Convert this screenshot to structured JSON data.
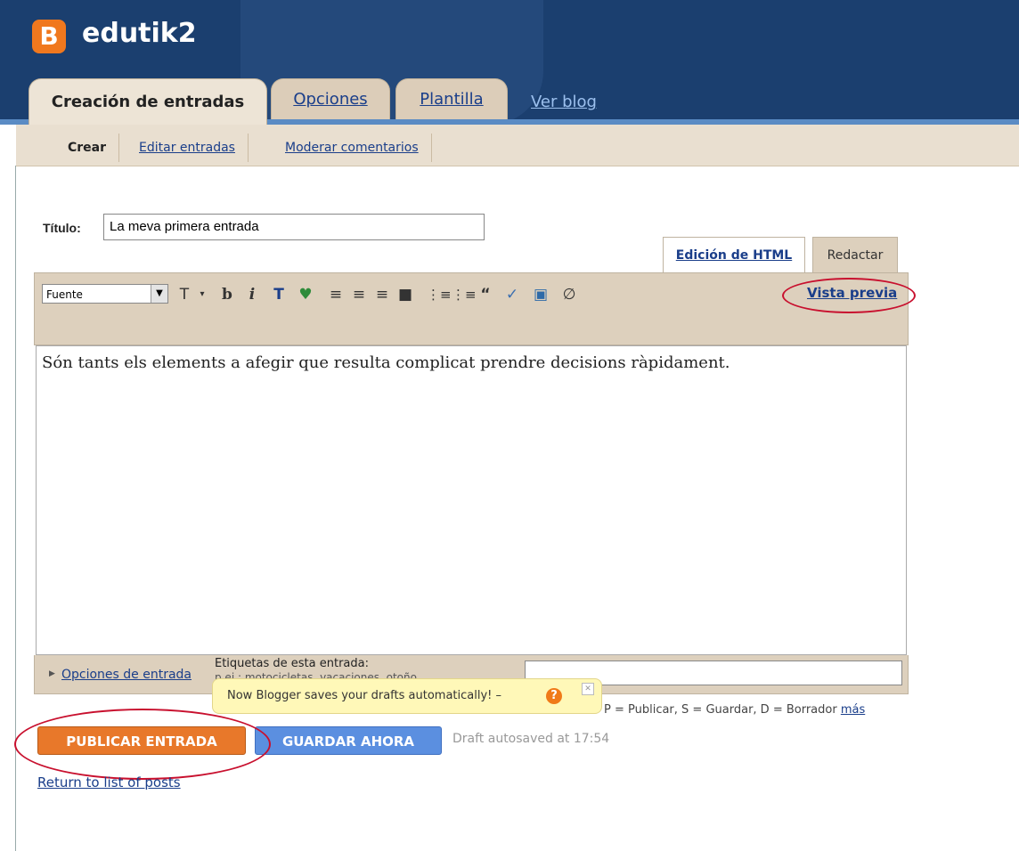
{
  "header": {
    "blog_name": "edutik2",
    "logo_letter": "B"
  },
  "main_tabs": [
    {
      "label": "Creación de entradas",
      "active": true
    },
    {
      "label": "Opciones",
      "active": false
    },
    {
      "label": "Plantilla",
      "active": false
    }
  ],
  "ver_blog": "Ver blog",
  "sub_tabs": [
    {
      "label": "Crear",
      "active": true
    },
    {
      "label": "Editar entradas",
      "active": false
    },
    {
      "label": "Moderar comentarios",
      "active": false
    }
  ],
  "post": {
    "title_label": "Título:",
    "title_value": "La meva primera entrada",
    "body": "Són tants els elements a afegir que resulta complicat prendre decisions ràpidament."
  },
  "mode_tabs": {
    "html": "Edición de HTML",
    "compose": "Redactar"
  },
  "toolbar": {
    "font_select": "Fuente",
    "preview_link": "Vista previa"
  },
  "bottom": {
    "post_options": "Opciones de entrada",
    "labels_title": "Etiquetas de esta entrada:",
    "labels_hint": "p.ej.: motocicletas, vacaciones, otoño"
  },
  "tooltip": {
    "text": "Now Blogger saves your drafts automatically! –"
  },
  "shortcuts": {
    "text": "P = Publicar, S = Guardar, D = Borrador",
    "more": "más"
  },
  "buttons": {
    "publish": "PUBLICAR ENTRADA",
    "save": "GUARDAR AHORA"
  },
  "status": {
    "autosave": "Draft autosaved at 17:54"
  },
  "return_link": "Return to list of posts",
  "colors": {
    "header_bg": "#1b3f6f",
    "publish": "#e8782a",
    "save": "#5b8fe0",
    "annotation": "#c8102e"
  }
}
